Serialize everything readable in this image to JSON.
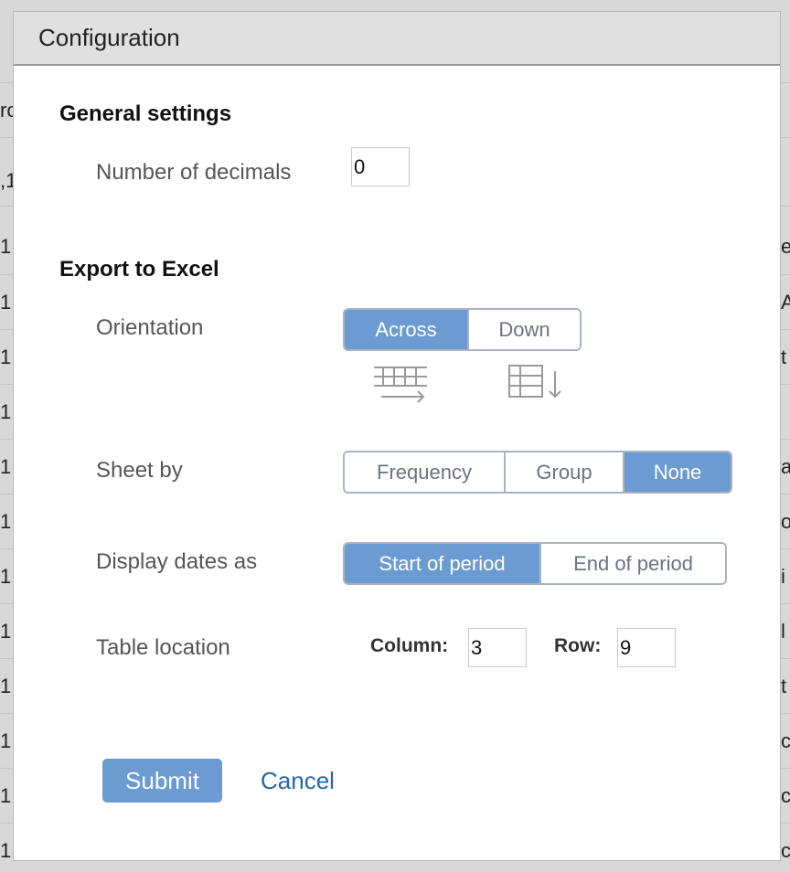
{
  "dialog": {
    "title": "Configuration",
    "general_section": "General settings",
    "decimals_label": "Number of decimals",
    "decimals_value": "0",
    "export_section": "Export to Excel",
    "orientation": {
      "label": "Orientation",
      "options": [
        "Across",
        "Down"
      ],
      "selected": "Across"
    },
    "sheet_by": {
      "label": "Sheet by",
      "options": [
        "Frequency",
        "Group",
        "None"
      ],
      "selected": "None"
    },
    "display_dates": {
      "label": "Display dates as",
      "options": [
        "Start of period",
        "End of period"
      ],
      "selected": "Start of period"
    },
    "table_location": {
      "label": "Table location",
      "column_label": "Column:",
      "column_value": "3",
      "row_label": "Row:",
      "row_value": "9"
    },
    "submit_label": "Submit",
    "cancel_label": "Cancel"
  },
  "colors": {
    "accent": "#6b9bd0",
    "link": "#2466ad",
    "segment_border": "#a9b4c2"
  },
  "icons": [
    "across-orientation-icon",
    "down-orientation-icon"
  ],
  "background_sheet": {
    "left_cells": [
      "ro",
      ",1",
      "1",
      "1",
      "1",
      "1",
      "1",
      "1",
      "1",
      "1",
      "1",
      "1",
      "1",
      "1"
    ],
    "right_cells": [
      "e",
      "A",
      "t",
      "a",
      "o",
      "i",
      "l",
      "t",
      "c",
      "c",
      "c"
    ]
  }
}
